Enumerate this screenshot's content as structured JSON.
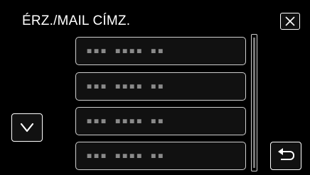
{
  "header": {
    "title": "ÉRZ./MAIL CÍMZ.",
    "close_icon": "close-icon"
  },
  "list": {
    "items": [
      {
        "label": "▪▪▪ ▪▪▪▪ ▪▪"
      },
      {
        "label": "▪▪▪ ▪▪▪▪ ▪▪"
      },
      {
        "label": "▪▪▪ ▪▪▪▪ ▪▪"
      },
      {
        "label": "▪▪▪ ▪▪▪▪ ▪▪"
      }
    ]
  },
  "controls": {
    "scroll_down_icon": "chevron-down-icon",
    "back_icon": "return-arrow-icon"
  },
  "colors": {
    "background": "#000000",
    "border": "#cfcfcf",
    "placeholder_text": "#8a8a8a"
  }
}
